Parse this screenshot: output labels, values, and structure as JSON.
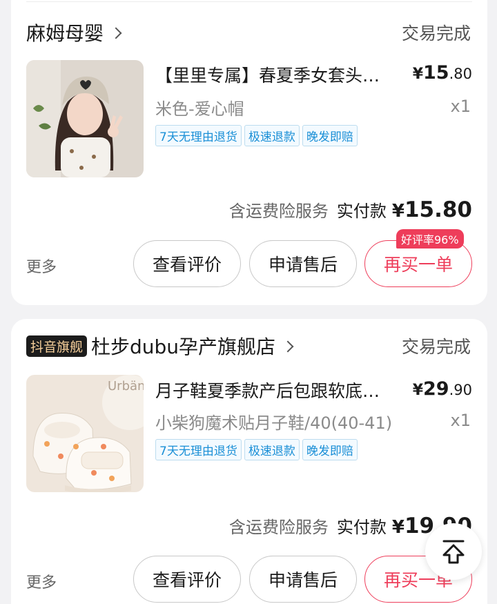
{
  "orders": [
    {
      "shop": {
        "name": "麻姆母婴",
        "badge": "",
        "status": "交易完成"
      },
      "item": {
        "title": "【里里专属】春夏季女套头月子帽",
        "variant": "米色-爱心帽",
        "price_yen": "¥",
        "price_int": "15",
        "price_dec": ".80",
        "qty": "x1",
        "tags": [
          "7天无理由退货",
          "极速退款",
          "晚发即赔"
        ]
      },
      "total": {
        "insurance": "含运费险服务",
        "paid_label": "实付款",
        "currency": "¥",
        "amount": "15.80"
      },
      "actions": {
        "more": "更多",
        "review": "查看评价",
        "aftersale": "申请售后",
        "rebuy": "再买一单",
        "rating_badge": "好评率96%"
      }
    },
    {
      "shop": {
        "name": "杜步dubu孕产旗舰店",
        "badge": "抖音旗舰",
        "status": "交易完成"
      },
      "item": {
        "title": "月子鞋夏季款产后包跟软底防滑",
        "variant": "小柴狗魔术贴月子鞋/40(40-41)",
        "price_yen": "¥",
        "price_int": "29",
        "price_dec": ".90",
        "qty": "x1",
        "tags": [
          "7天无理由退货",
          "极速退款",
          "晚发即赔"
        ]
      },
      "total": {
        "insurance": "含运费险服务",
        "paid_label": "实付款",
        "currency": "¥",
        "amount": "19.90"
      },
      "actions": {
        "more": "更多",
        "review": "查看评价",
        "aftersale": "申请售后",
        "rebuy": "再买一单"
      }
    }
  ],
  "colors": {
    "accent": "#ee3d5a",
    "tag_blue": "#1a8fd6",
    "badge_gold": "#f6cf9a"
  },
  "icons": {
    "back_to_top": "arrow-up-to-line-icon",
    "shop_chevron": "chevron-right-icon"
  }
}
